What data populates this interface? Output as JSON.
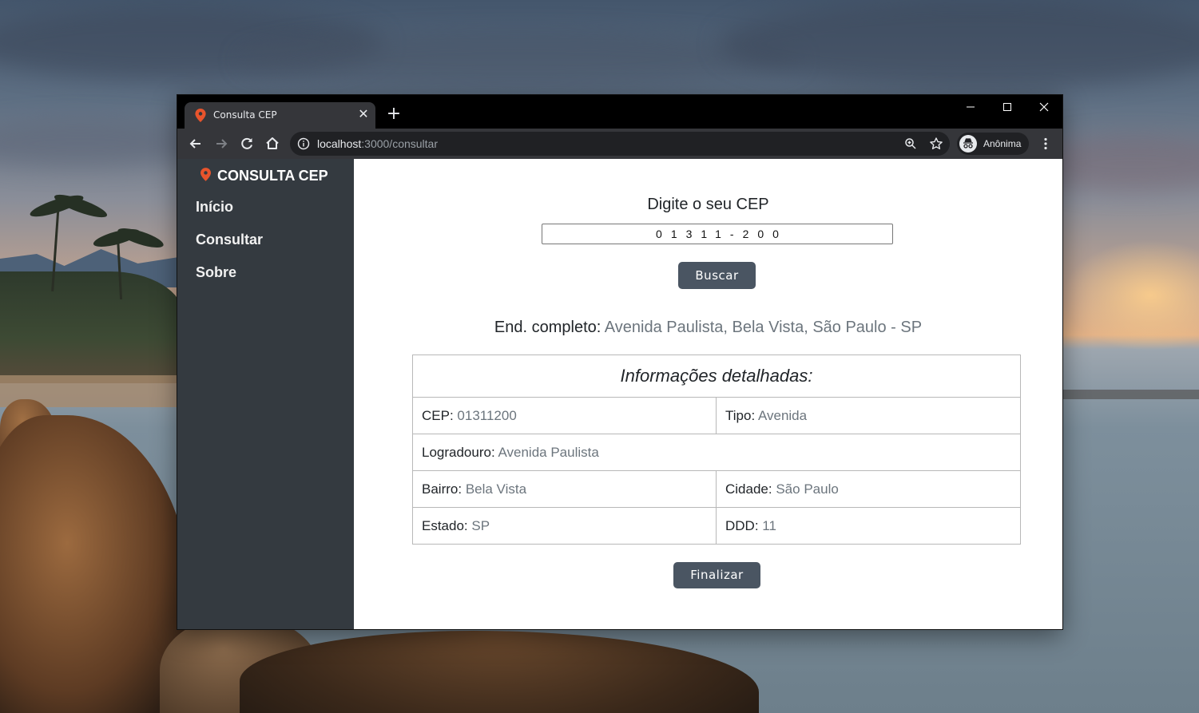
{
  "browser": {
    "tab_title": "Consulta CEP",
    "url_host": "localhost",
    "url_path": ":3000/consultar",
    "profile_label": "Anônima",
    "accent": "#e8542c"
  },
  "sidebar": {
    "brand": "CONSULTA CEP",
    "items": [
      {
        "label": "Início"
      },
      {
        "label": "Consultar"
      },
      {
        "label": "Sobre"
      }
    ]
  },
  "form": {
    "label": "Digite o seu CEP",
    "cep_value": "01311-200",
    "search_button": "Buscar"
  },
  "result": {
    "full_address_label": "End. completo:",
    "full_address_value": "Avenida Paulista, Bela Vista, São Paulo - SP",
    "details_title": "Informações detalhadas:",
    "fields": {
      "cep": {
        "label": "CEP:",
        "value": "01311200"
      },
      "tipo": {
        "label": "Tipo:",
        "value": "Avenida"
      },
      "logradouro": {
        "label": "Logradouro:",
        "value": "Avenida Paulista"
      },
      "bairro": {
        "label": "Bairro:",
        "value": "Bela Vista"
      },
      "cidade": {
        "label": "Cidade:",
        "value": "São Paulo"
      },
      "estado": {
        "label": "Estado:",
        "value": "SP"
      },
      "ddd": {
        "label": "DDD:",
        "value": "11"
      }
    },
    "finish_button": "Finalizar"
  }
}
